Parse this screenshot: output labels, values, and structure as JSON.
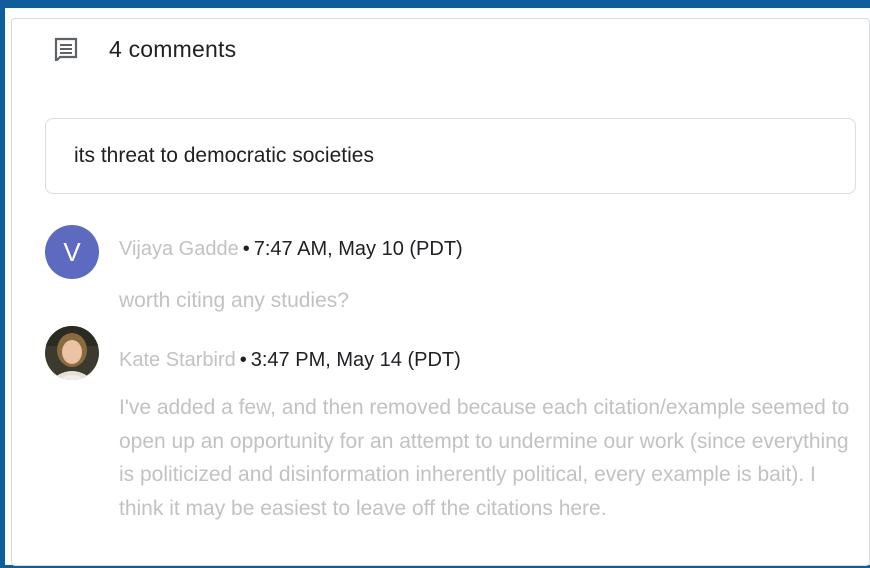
{
  "header": {
    "icon": "comment-icon",
    "count_label": "4 comments"
  },
  "quoted_text": "its threat to democratic societies",
  "comments": [
    {
      "avatar_letter": "V",
      "avatar_color": "#5c6bc0",
      "author": "Vijaya Gadde",
      "separator": "•",
      "timestamp": "7:47 AM, May 10 (PDT)",
      "text": "worth citing any studies?"
    },
    {
      "avatar_letter": "",
      "author": "Kate Starbird",
      "separator": "•",
      "timestamp": "3:47 PM, May 14 (PDT)",
      "text": "I've added a few, and then removed because each citation/example seemed to open up an opportunity for an attempt to undermine our work (since everything is politicized and disinformation inherently political, every example is bait). I think it may be easiest to leave off the citations here."
    }
  ],
  "colors": {
    "frame_border": "#0f5e9c",
    "muted_text": "#c2c2c2",
    "primary_text": "#202124"
  }
}
